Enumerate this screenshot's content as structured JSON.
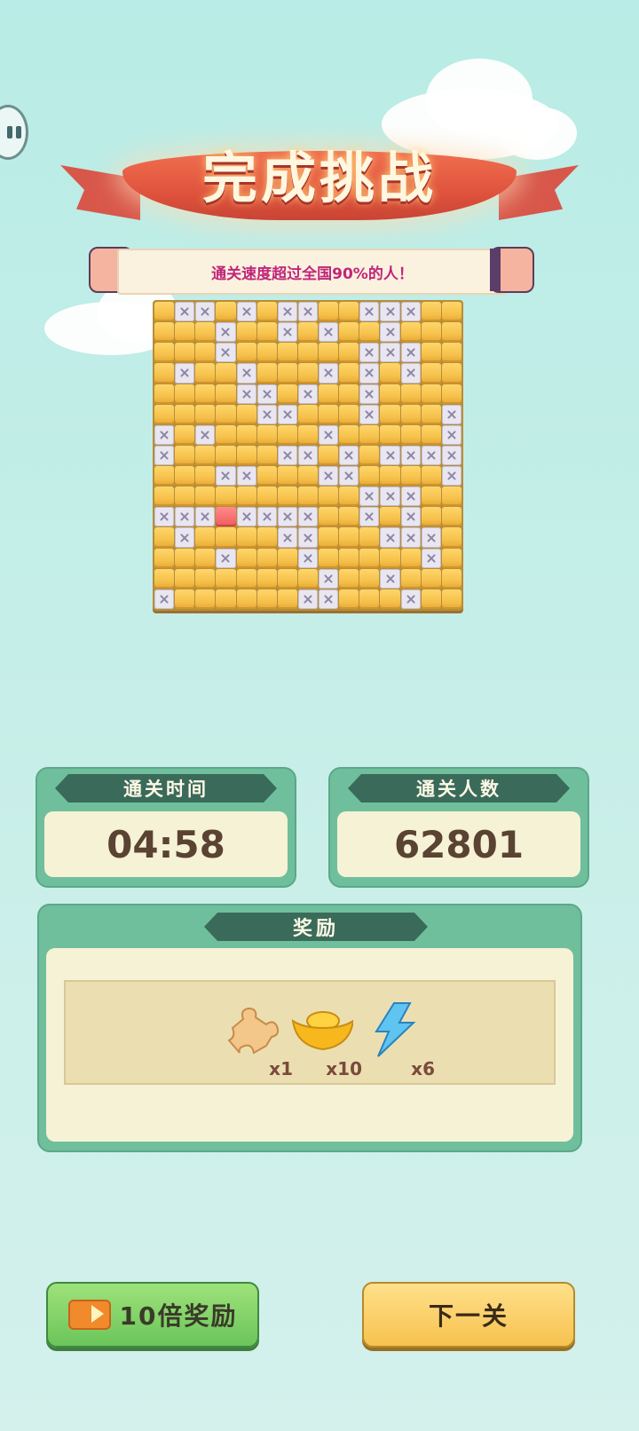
{
  "banner": {
    "title": "完成挑战",
    "subtitle": "通关速度超过全国90%的人！"
  },
  "stats": {
    "time_label": "通关时间",
    "time_value": "04:58",
    "players_label": "通关人数",
    "players_value": "62801"
  },
  "reward": {
    "title": "奖励",
    "items": [
      {
        "icon": "puzzle-piece-icon",
        "qty": "x1"
      },
      {
        "icon": "gold-ingot-icon",
        "qty": "x10"
      },
      {
        "icon": "lightning-icon",
        "qty": "x6"
      }
    ]
  },
  "buttons": {
    "reward10x": "10倍奖励",
    "next": "下一关"
  },
  "board": {
    "size": 15,
    "rows": [
      "G X X G X G X X G G X X X G G",
      "G G G X G G X G X G G X G G G",
      "G G G X G G G G G G X X X G G",
      "G X G G X G G G X G X G X G G",
      "G G G G X X G X G G X G G G G",
      "G G G G G X X G G G X G G G X",
      "X G X G G G G G X G G G G G X",
      "X G G G G G X X G X G X X X X",
      "G G G X X G G G X X G G G G X",
      "G G G G G G G G G G X X X G G",
      "X X X R X X X X G G X G X G G",
      "G X G G G G X X G G G X X X G",
      "G G G X G G G X G G G G G X G",
      "G G G G G G G G X G G X G G G",
      "X G G G G G G X X G G G X G G"
    ]
  },
  "colors": {
    "gold": "#f6c24c",
    "cross": "#e9e6f0",
    "red": "#ef5d5d"
  }
}
